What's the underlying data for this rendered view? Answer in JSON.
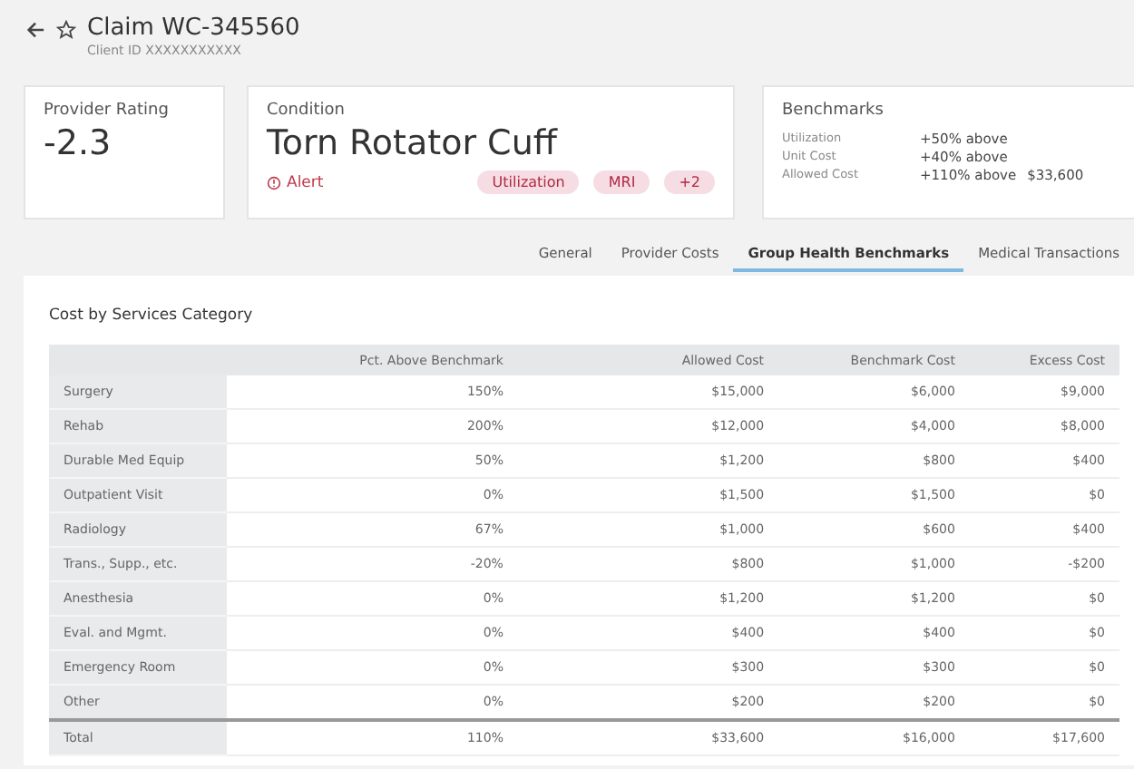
{
  "header": {
    "title": "Claim WC-345560",
    "subtitle": "Client ID XXXXXXXXXXX"
  },
  "provider": {
    "label": "Provider Rating",
    "value": "-2.3"
  },
  "condition": {
    "label": "Condition",
    "name": "Torn Rotator Cuff",
    "alert": "Alert",
    "tags": [
      "Utilization",
      "MRI",
      "+2"
    ]
  },
  "benchmarks": {
    "title": "Benchmarks",
    "rows": [
      {
        "label": "Utilization",
        "value": "+50% above"
      },
      {
        "label": "Unit Cost",
        "value": "+40% above"
      },
      {
        "label": "Allowed Cost",
        "value": "+110% above",
        "extra": "$33,600"
      }
    ]
  },
  "tabs": [
    {
      "label": "General",
      "selected": false
    },
    {
      "label": "Provider Costs",
      "selected": false
    },
    {
      "label": "Group Health Benchmarks",
      "selected": true
    },
    {
      "label": "Medical Transactions",
      "selected": false
    }
  ],
  "table": {
    "title": "Cost by Services Category",
    "columns": [
      "",
      "Pct. Above Benchmark",
      "Allowed Cost",
      "Benchmark Cost",
      "Excess Cost"
    ],
    "rows": [
      [
        "Surgery",
        "150%",
        "$15,000",
        "$6,000",
        "$9,000"
      ],
      [
        "Rehab",
        "200%",
        "$12,000",
        "$4,000",
        "$8,000"
      ],
      [
        "Durable Med Equip",
        "50%",
        "$1,200",
        "$800",
        "$400"
      ],
      [
        "Outpatient Visit",
        "0%",
        "$1,500",
        "$1,500",
        "$0"
      ],
      [
        "Radiology",
        "67%",
        "$1,000",
        "$600",
        "$400"
      ],
      [
        "Trans., Supp., etc.",
        "-20%",
        "$800",
        "$1,000",
        "-$200"
      ],
      [
        "Anesthesia",
        "0%",
        "$1,200",
        "$1,200",
        "$0"
      ],
      [
        "Eval. and Mgmt.",
        "0%",
        "$400",
        "$400",
        "$0"
      ],
      [
        "Emergency Room",
        "0%",
        "$300",
        "$300",
        "$0"
      ],
      [
        "Other",
        "0%",
        "$200",
        "$200",
        "$0"
      ]
    ],
    "total": [
      "Total",
      "110%",
      "$33,600",
      "$16,000",
      "$17,600"
    ]
  }
}
